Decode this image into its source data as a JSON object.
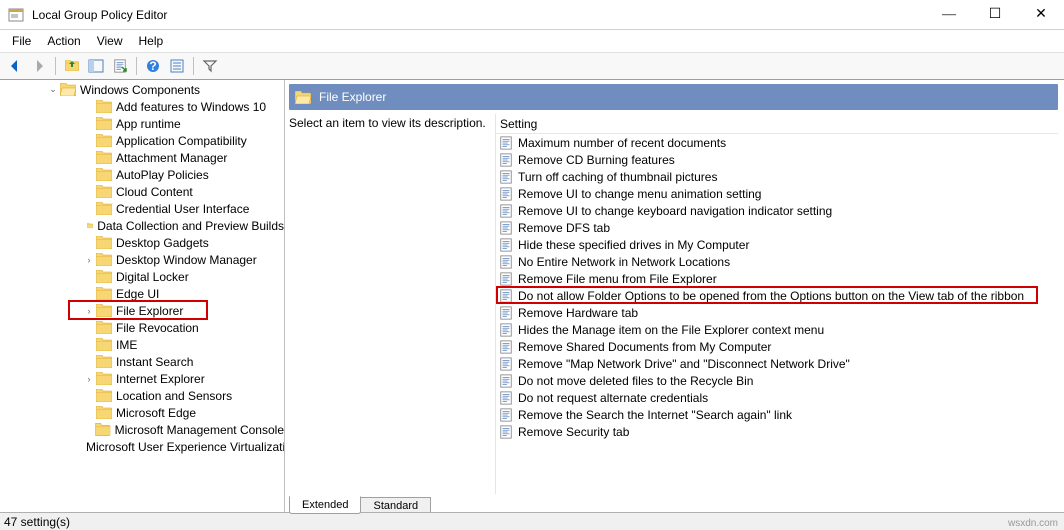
{
  "window": {
    "title": "Local Group Policy Editor"
  },
  "menu": {
    "items": [
      "File",
      "Action",
      "View",
      "Help"
    ]
  },
  "tree": {
    "root": "Windows Components",
    "items": [
      {
        "label": "Add features to Windows 10",
        "indent": 2
      },
      {
        "label": "App runtime",
        "indent": 2
      },
      {
        "label": "Application Compatibility",
        "indent": 2
      },
      {
        "label": "Attachment Manager",
        "indent": 2
      },
      {
        "label": "AutoPlay Policies",
        "indent": 2
      },
      {
        "label": "Cloud Content",
        "indent": 2
      },
      {
        "label": "Credential User Interface",
        "indent": 2
      },
      {
        "label": "Data Collection and Preview Builds",
        "indent": 2
      },
      {
        "label": "Desktop Gadgets",
        "indent": 2
      },
      {
        "label": "Desktop Window Manager",
        "indent": 2,
        "caret": true
      },
      {
        "label": "Digital Locker",
        "indent": 2
      },
      {
        "label": "Edge UI",
        "indent": 2
      },
      {
        "label": "File Explorer",
        "indent": 2,
        "caret": true,
        "highlight": true
      },
      {
        "label": "File Revocation",
        "indent": 2
      },
      {
        "label": "IME",
        "indent": 2
      },
      {
        "label": "Instant Search",
        "indent": 2
      },
      {
        "label": "Internet Explorer",
        "indent": 2,
        "caret": true
      },
      {
        "label": "Location and Sensors",
        "indent": 2
      },
      {
        "label": "Microsoft Edge",
        "indent": 2
      },
      {
        "label": "Microsoft Management Console",
        "indent": 2
      },
      {
        "label": "Microsoft User Experience Virtualization",
        "indent": 2
      }
    ]
  },
  "detail": {
    "header": "File Explorer",
    "desc": "Select an item to view its description.",
    "column_header": "Setting",
    "settings": [
      "Maximum number of recent documents",
      "Remove CD Burning features",
      "Turn off caching of thumbnail pictures",
      "Remove UI to change menu animation setting",
      "Remove UI to change keyboard navigation indicator setting",
      "Remove DFS tab",
      "Hide these specified drives in My Computer",
      "No Entire Network in Network Locations",
      "Remove File menu from File Explorer",
      "Do not allow Folder Options to be opened from the Options button on the View tab of the ribbon",
      "Remove Hardware tab",
      "Hides the Manage item on the File Explorer context menu",
      "Remove Shared Documents from My Computer",
      "Remove \"Map Network Drive\" and \"Disconnect Network Drive\"",
      "Do not move deleted files to the Recycle Bin",
      "Do not request alternate credentials",
      "Remove the Search the Internet \"Search again\" link",
      "Remove Security tab"
    ],
    "highlight_index": 9
  },
  "tabs": {
    "extended": "Extended",
    "standard": "Standard"
  },
  "status": "47 setting(s)",
  "watermark": "wsxdn.com"
}
